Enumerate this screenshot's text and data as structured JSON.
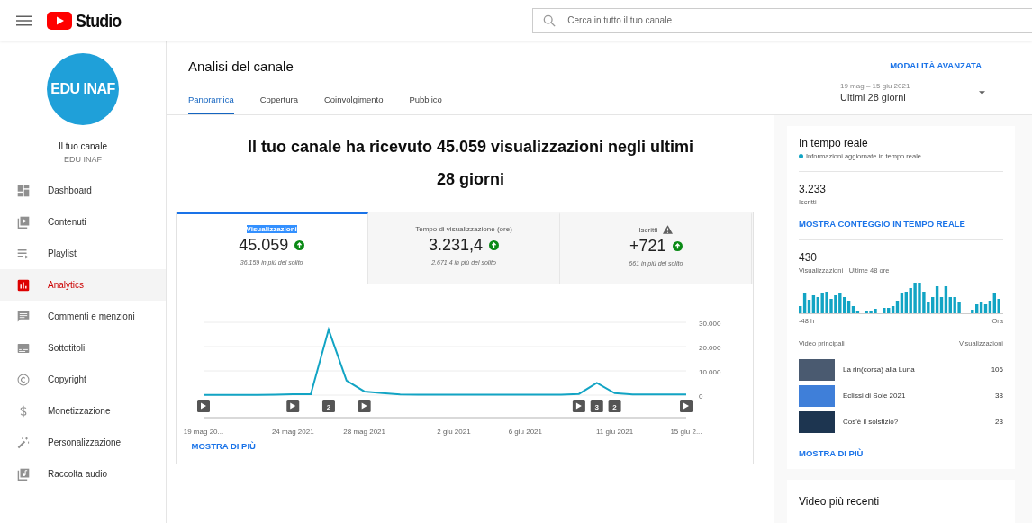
{
  "topbar": {
    "logo_text": "Studio",
    "search": {
      "placeholder": "Cerca in tutto il tuo canale"
    }
  },
  "sidebar": {
    "avatar_text": "EDU INAF",
    "channel_label": "Il tuo canale",
    "channel_name": "EDU INAF",
    "items": [
      {
        "label": "Dashboard",
        "kind": "dashboard",
        "selected": false
      },
      {
        "label": "Contenuti",
        "kind": "content",
        "selected": false
      },
      {
        "label": "Playlist",
        "kind": "playlist",
        "selected": false
      },
      {
        "label": "Analytics",
        "kind": "analytics",
        "selected": true
      },
      {
        "label": "Commenti e menzioni",
        "kind": "comments",
        "selected": false
      },
      {
        "label": "Sottotitoli",
        "kind": "subtitles",
        "selected": false
      },
      {
        "label": "Copyright",
        "kind": "copyright",
        "selected": false
      },
      {
        "label": "Monetizzazione",
        "kind": "money",
        "selected": false
      },
      {
        "label": "Personalizzazione",
        "kind": "wand",
        "selected": false
      },
      {
        "label": "Raccolta audio",
        "kind": "audio",
        "selected": false
      }
    ]
  },
  "header": {
    "title": "Analisi del canale",
    "advanced_link": "MODALITÀ AVANZATA",
    "tabs": [
      {
        "label": "Panoramica",
        "selected": true
      },
      {
        "label": "Copertura",
        "selected": false
      },
      {
        "label": "Coinvolgimento",
        "selected": false
      },
      {
        "label": "Pubblico",
        "selected": false
      }
    ],
    "date_range": {
      "dates": "19 mag – 15 giu 2021",
      "period": "Ultimi 28 giorni"
    }
  },
  "summary": "Il tuo canale ha ricevuto 45.059 visualizzazioni negli ultimi 28 giorni",
  "metrics": {
    "tabs": [
      {
        "label": "Visualizzazioni",
        "value": "45.059",
        "delta": "36.159 in più del solito",
        "selected": true,
        "highlighted": true,
        "warning": false
      },
      {
        "label": "Tempo di visualizzazione (ore)",
        "value": "3.231,4",
        "delta": "2.671,4 in più del solito",
        "selected": false,
        "highlighted": false,
        "warning": false
      },
      {
        "label": "Iscritti",
        "value": "+721",
        "delta": "661 in più del solito",
        "selected": false,
        "highlighted": false,
        "warning": true
      }
    ],
    "chart_data": {
      "type": "line",
      "categories": [
        "19 mag 20...",
        null,
        null,
        null,
        null,
        "24 mag 2021",
        null,
        null,
        null,
        "28 mag 2021",
        null,
        null,
        null,
        null,
        "2 giu 2021",
        null,
        null,
        null,
        "6 giu 2021",
        null,
        null,
        null,
        null,
        "11 giu 2021",
        null,
        null,
        null,
        "15 giu 2..."
      ],
      "series": [
        {
          "color": "#12a4c4",
          "values": [
            100,
            100,
            100,
            100,
            200,
            400,
            400,
            27000,
            6000,
            1500,
            800,
            300,
            200,
            200,
            200,
            200,
            200,
            200,
            200,
            200,
            200,
            500,
            5000,
            800,
            300,
            300,
            300,
            300
          ]
        }
      ],
      "ylim": [
        0,
        30000
      ],
      "yticks": [
        {
          "value": 0,
          "label": "0"
        },
        {
          "value": 10000,
          "label": "10.000"
        },
        {
          "value": 20000,
          "label": "20.000"
        },
        {
          "value": 30000,
          "label": "30.000"
        }
      ]
    },
    "day_markers": [
      {
        "kind": "video"
      },
      {
        "kind": "none"
      },
      {
        "kind": "none"
      },
      {
        "kind": "none"
      },
      {
        "kind": "none"
      },
      {
        "kind": "video"
      },
      {
        "kind": "none"
      },
      {
        "kind": "count",
        "text": "2"
      },
      {
        "kind": "none"
      },
      {
        "kind": "video"
      },
      {
        "kind": "none"
      },
      {
        "kind": "none"
      },
      {
        "kind": "none"
      },
      {
        "kind": "none"
      },
      {
        "kind": "none"
      },
      {
        "kind": "none"
      },
      {
        "kind": "none"
      },
      {
        "kind": "none"
      },
      {
        "kind": "none"
      },
      {
        "kind": "none"
      },
      {
        "kind": "none"
      },
      {
        "kind": "video"
      },
      {
        "kind": "count",
        "text": "3"
      },
      {
        "kind": "count",
        "text": "2"
      },
      {
        "kind": "none"
      },
      {
        "kind": "none"
      },
      {
        "kind": "none"
      },
      {
        "kind": "video"
      }
    ],
    "more_link": "MOSTRA DI PIÙ"
  },
  "realtime": {
    "title": "In tempo reale",
    "status": "Informazioni aggiornate in tempo reale",
    "subscribers": "3.233",
    "subscribers_label": "Iscritti",
    "live_link": "MOSTRA CONTEGGIO IN TEMPO REALE",
    "views": "430",
    "views_label": "Visualizzazioni · Ultime 48 ore",
    "axis_start": "-48 h",
    "axis_end": "Ora",
    "videos_heading": "Video principali",
    "views_heading": "Visualizzazioni",
    "videos": [
      {
        "title": "La rin(corsa) alla Luna",
        "views": "106"
      },
      {
        "title": "Eclissi di Sole 2021",
        "views": "38"
      },
      {
        "title": "Cos'è il solstizio?",
        "views": "23"
      }
    ],
    "more_link": "MOSTRA DI PIÙ"
  },
  "recent": {
    "title": "Video più recenti"
  }
}
